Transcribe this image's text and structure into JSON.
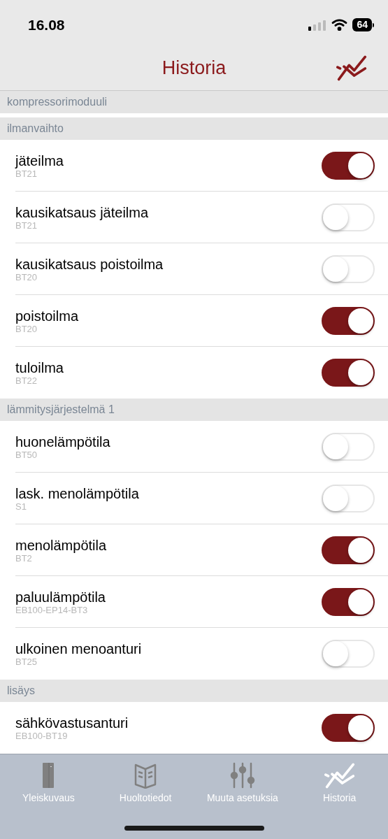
{
  "status_bar": {
    "time": "16.08",
    "battery": "64"
  },
  "header": {
    "title": "Historia"
  },
  "sections": [
    {
      "title": "kompressorimoduuli"
    },
    {
      "title": "ilmanvaihto",
      "items": [
        {
          "name": "jäteilma",
          "code": "BT21",
          "on": true
        },
        {
          "name": "kausikatsaus jäteilma",
          "code": "BT21",
          "on": false
        },
        {
          "name": "kausikatsaus poistoilma",
          "code": "BT20",
          "on": false
        },
        {
          "name": "poistoilma",
          "code": "BT20",
          "on": true
        },
        {
          "name": "tuloilma",
          "code": "BT22",
          "on": true
        }
      ]
    },
    {
      "title": "lämmitysjärjestelmä 1",
      "items": [
        {
          "name": "huonelämpötila",
          "code": "BT50",
          "on": false
        },
        {
          "name": "lask. menolämpötila",
          "code": "S1",
          "on": false
        },
        {
          "name": "menolämpötila",
          "code": "BT2",
          "on": true
        },
        {
          "name": "paluulämpötila",
          "code": "EB100-EP14-BT3",
          "on": true
        },
        {
          "name": "ulkoinen menoanturi",
          "code": "BT25",
          "on": false
        }
      ]
    },
    {
      "title": "lisäys",
      "items": [
        {
          "name": "sähkövastusanturi",
          "code": "EB100-BT19",
          "on": true
        }
      ]
    }
  ],
  "tabs": [
    {
      "label": "Yleiskuvaus",
      "kind": "cabinet",
      "selected": false
    },
    {
      "label": "Huoltotiedot",
      "kind": "book",
      "selected": false
    },
    {
      "label": "Muuta asetuksia",
      "kind": "sliders",
      "selected": false
    },
    {
      "label": "Historia",
      "kind": "chart",
      "selected": true
    }
  ]
}
